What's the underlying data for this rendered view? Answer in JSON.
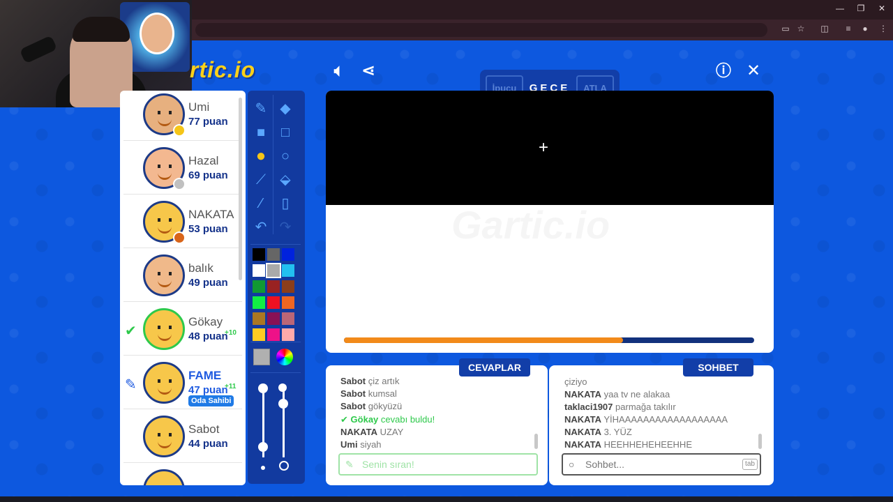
{
  "browser": {
    "window_controls": [
      "—",
      "❐",
      "✕"
    ],
    "toolbar_icons": [
      "cast-icon",
      "star-icon",
      "extension-icon",
      "playlist-icon",
      "profile-icon",
      "menu-icon"
    ]
  },
  "logo": "Gartic.io",
  "word_header": {
    "hint_label": "İpucu",
    "word": "GECE",
    "skip_label": "ATLA"
  },
  "players": [
    {
      "name": "Umi",
      "score": "77 puan",
      "dot_color": "#f5c518"
    },
    {
      "name": "Hazal",
      "score": "69 puan",
      "dot_color": "#c0c0c0"
    },
    {
      "name": "NAKATA",
      "score": "53 puan",
      "dot_color": "#d8651a"
    },
    {
      "name": "balık",
      "score": "49 puan",
      "dot_color": ""
    },
    {
      "name": "Gökay",
      "score": "48 puan",
      "plus": "+10",
      "mark": "✔"
    },
    {
      "name": "FAME",
      "score": "47 puan",
      "plus": "+11",
      "mark": "✎",
      "badge": "Oda Sahibi",
      "is_me": true
    },
    {
      "name": "Sabot",
      "score": "44 puan",
      "dot_color": ""
    }
  ],
  "palette": [
    "#000000",
    "#666666",
    "#0022dd",
    "#ffffff",
    "#aaaaaa",
    "#22c0f0",
    "#119933",
    "#992222",
    "#8b3e1a",
    "#11ee44",
    "#ee1122",
    "#ee6622",
    "#aa7722",
    "#881155",
    "#bb6677",
    "#ffcc22",
    "#ee1188",
    "#ffaaaa"
  ],
  "selected_color_index": 4,
  "timer": {
    "progress": 0.68
  },
  "answers": {
    "header": "CEVAPLAR",
    "messages": [
      {
        "user": "Sabot",
        "text": "çiz artık"
      },
      {
        "user": "Sabot",
        "text": "kumsal"
      },
      {
        "user": "Sabot",
        "text": "gökyüzü"
      },
      {
        "user": "Gökay",
        "text": "cevabı buldu!",
        "correct": true
      },
      {
        "user": "NAKATA",
        "text": "UZAY"
      },
      {
        "user": "Umi",
        "text": "siyah"
      }
    ],
    "placeholder": "Senin sıran!"
  },
  "chat": {
    "header": "SOHBET",
    "messages": [
      {
        "user": "",
        "text": "çiziyo"
      },
      {
        "user": "NAKATA",
        "text": "yaa tv ne alakaa"
      },
      {
        "user": "taklaci1907",
        "text": "parmağa takılır"
      },
      {
        "user": "NAKATA",
        "text": "YİHAAAAAAAAAAAAAAAAAA"
      },
      {
        "user": "NAKATA",
        "text": "3. YÜZ"
      },
      {
        "user": "NAKATA",
        "text": "HEEHHEHEHEEHHE"
      }
    ],
    "placeholder": "Sohbet...",
    "tab_hint": "tab"
  }
}
